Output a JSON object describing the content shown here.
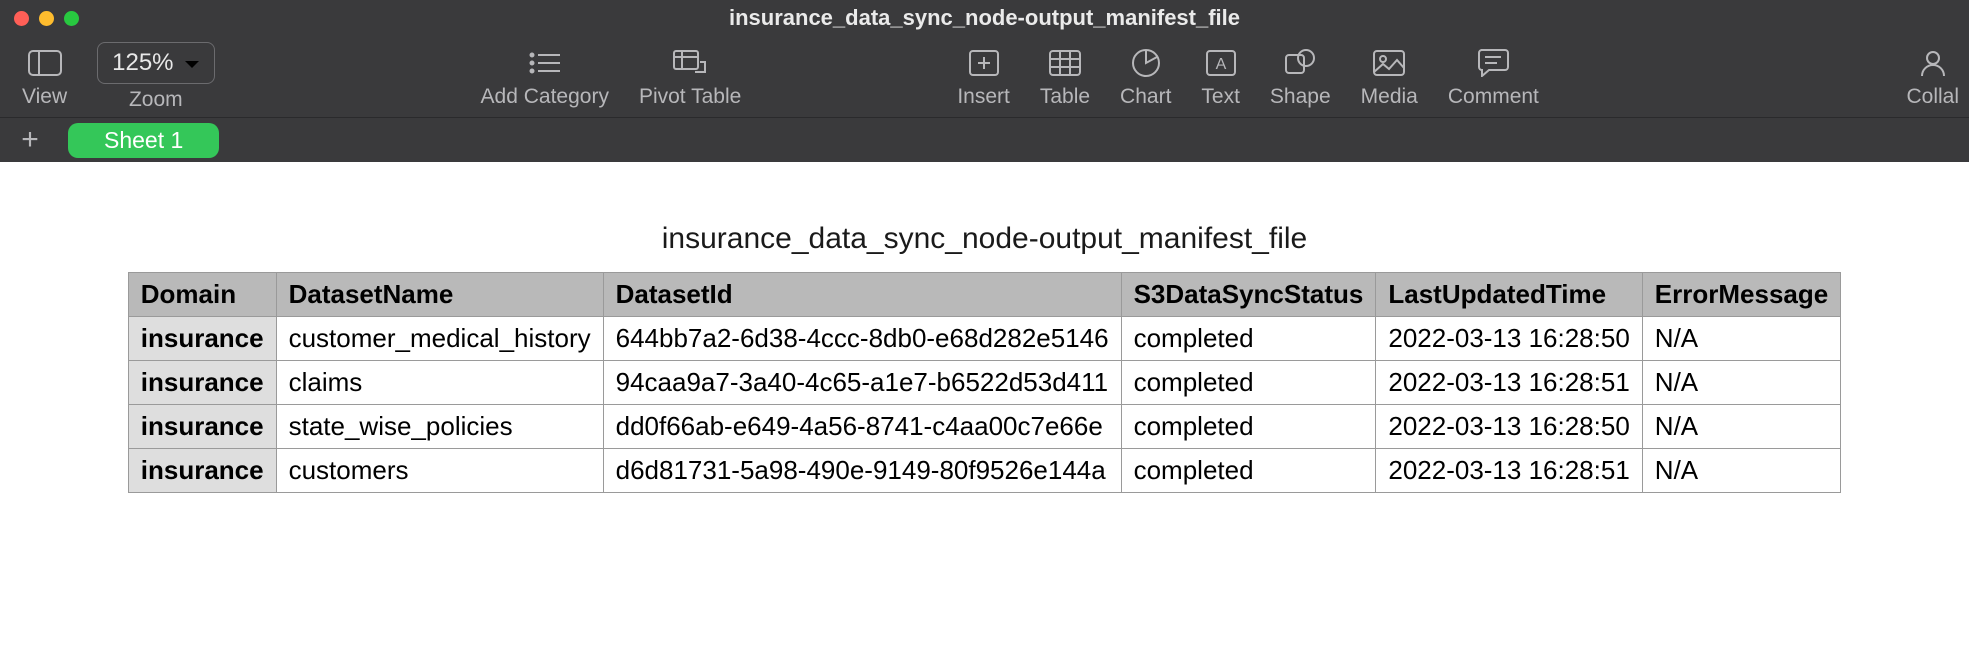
{
  "window": {
    "title": "insurance_data_sync_node-output_manifest_file"
  },
  "toolbar": {
    "view_label": "View",
    "zoom_label": "Zoom",
    "zoom_value": "125%",
    "add_category_label": "Add Category",
    "pivot_table_label": "Pivot Table",
    "insert_label": "Insert",
    "table_label": "Table",
    "chart_label": "Chart",
    "text_label": "Text",
    "shape_label": "Shape",
    "media_label": "Media",
    "comment_label": "Comment",
    "collaborate_label": "Collal"
  },
  "sheetbar": {
    "active_tab": "Sheet 1"
  },
  "table": {
    "title": "insurance_data_sync_node-output_manifest_file",
    "headers": [
      "Domain",
      "DatasetName",
      "DatasetId",
      "S3DataSyncStatus",
      "LastUpdatedTime",
      "ErrorMessage"
    ],
    "rows": [
      {
        "domain": "insurance",
        "dataset_name": "customer_medical_history",
        "dataset_id": "644bb7a2-6d38-4ccc-8db0-e68d282e5146",
        "status": "completed",
        "updated": "2022-03-13 16:28:50",
        "error": "N/A"
      },
      {
        "domain": "insurance",
        "dataset_name": "claims",
        "dataset_id": "94caa9a7-3a40-4c65-a1e7-b6522d53d411",
        "status": "completed",
        "updated": "2022-03-13 16:28:51",
        "error": "N/A"
      },
      {
        "domain": "insurance",
        "dataset_name": "state_wise_policies",
        "dataset_id": "dd0f66ab-e649-4a56-8741-c4aa00c7e66e",
        "status": "completed",
        "updated": "2022-03-13 16:28:50",
        "error": "N/A"
      },
      {
        "domain": "insurance",
        "dataset_name": "customers",
        "dataset_id": "d6d81731-5a98-490e-9149-80f9526e144a",
        "status": "completed",
        "updated": "2022-03-13 16:28:51",
        "error": "N/A"
      }
    ]
  }
}
